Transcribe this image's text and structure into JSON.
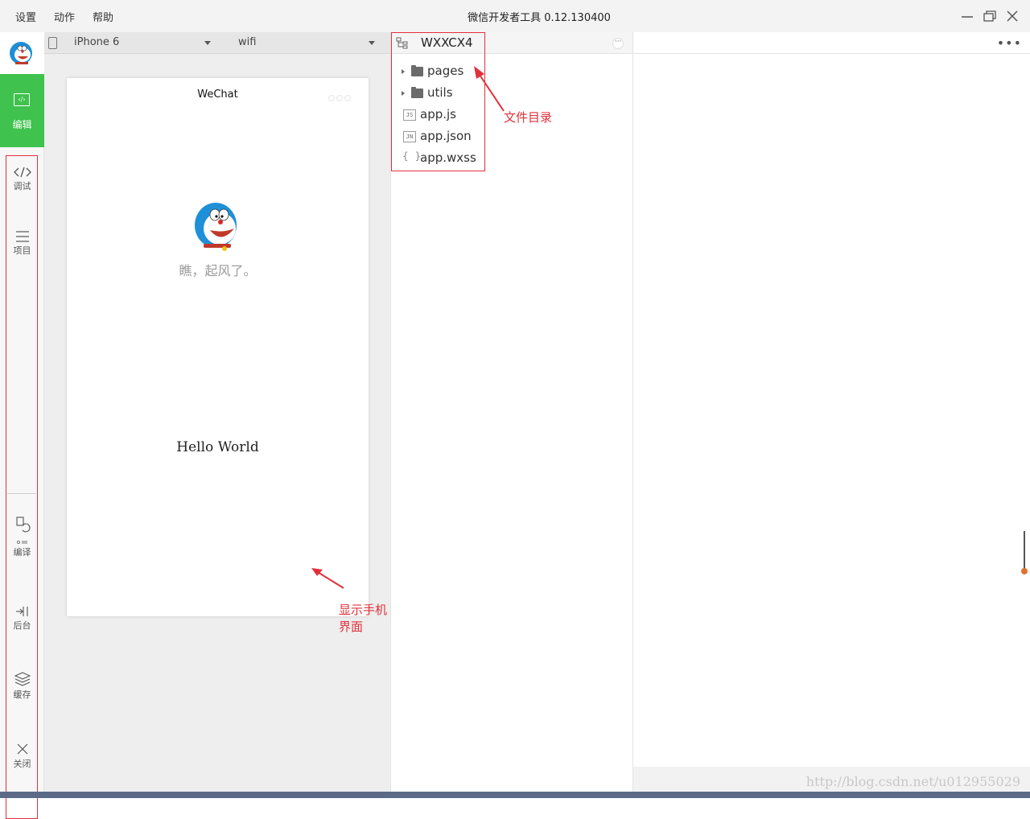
{
  "menu": {
    "settings": "设置",
    "actions": "动作",
    "help": "帮助"
  },
  "app_title": "微信开发者工具 0.12.130400",
  "sidebar": {
    "edit_label": "编辑",
    "items": [
      {
        "label": "调试",
        "icon": "code-icon"
      },
      {
        "label": "项目",
        "icon": "menu-icon"
      },
      {
        "label": "编译",
        "icon": "compile-icon"
      },
      {
        "label": "后台",
        "icon": "backend-icon"
      },
      {
        "label": "缓存",
        "icon": "layers-icon"
      },
      {
        "label": "关闭",
        "icon": "close-icon"
      }
    ]
  },
  "device_bar": {
    "device": "iPhone 6",
    "network": "wifi"
  },
  "phone": {
    "title": "WeChat",
    "motto": "瞧，起风了。",
    "hello": "Hello World"
  },
  "project": {
    "name": "WXXCX4",
    "files": [
      {
        "name": "pages",
        "type": "folder"
      },
      {
        "name": "utils",
        "type": "folder"
      },
      {
        "name": "app.js",
        "type": "file",
        "badge": "JS"
      },
      {
        "name": "app.json",
        "type": "file",
        "badge": "JN"
      },
      {
        "name": "app.wxss",
        "type": "file",
        "badge": "{ }"
      }
    ]
  },
  "annotations": {
    "file_dir": "文件目录",
    "phone_ui": "显示手机界面"
  },
  "watermark": "http://blog.csdn.net/u012955029",
  "colors": {
    "accent_green": "#3fc24e",
    "annotation_red": "#e0313b"
  }
}
